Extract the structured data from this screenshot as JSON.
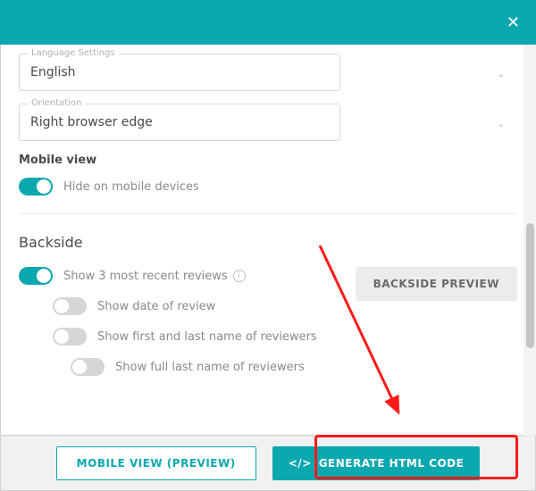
{
  "header": {
    "close": "✕"
  },
  "fields": {
    "language": {
      "label": "Language Settings",
      "value": "English"
    },
    "orientation": {
      "label": "Orientation",
      "value": "Right browser edge"
    }
  },
  "mobile": {
    "section_label": "Mobile view",
    "hide_label": "Hide on mobile devices"
  },
  "backside": {
    "title": "Backside",
    "show_recent": "Show 3 most recent reviews",
    "show_date": "Show date of review",
    "show_names": "Show first and last name of reviewers",
    "show_full_last": "Show full last name of reviewers",
    "preview_btn": "BACKSIDE PREVIEW"
  },
  "footer": {
    "mobile_preview": "MOBILE VIEW (PREVIEW)",
    "generate": "GENERATE HTML CODE"
  },
  "colors": {
    "accent": "#0ca8b0",
    "highlight": "#ff1a1a"
  }
}
